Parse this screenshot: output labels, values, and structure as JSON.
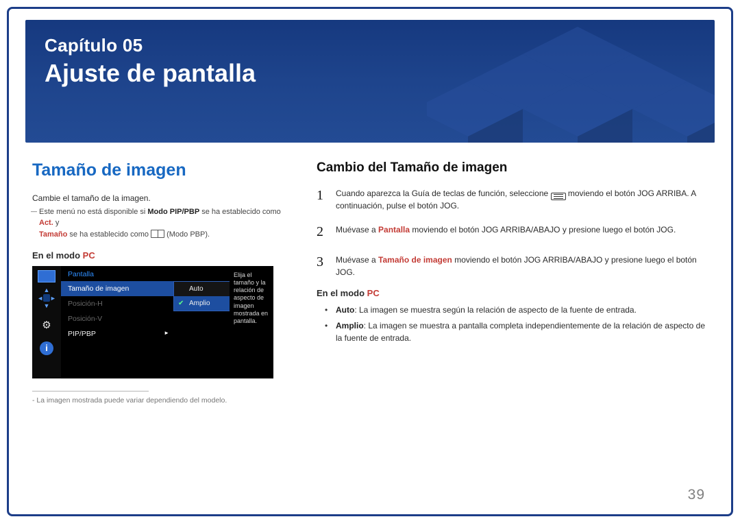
{
  "hero": {
    "chapter": "Capítulo 05",
    "title": "Ajuste de pantalla"
  },
  "left": {
    "heading": "Tamaño de imagen",
    "intro": "Cambie el tamaño de la imagen.",
    "note_pre": "Este menú no está disponible si ",
    "note_mid1": "Modo PIP/PBP",
    "note_mid2": " se ha establecido como ",
    "note_act": "Act.",
    "note_y": " y ",
    "note_tam": "Tamaño",
    "note_post1": " se ha establecido como ",
    "note_post2": " (Modo PBP).",
    "mode_label": "En el modo ",
    "mode_pc": "PC"
  },
  "osd": {
    "title": "Pantalla",
    "items": [
      "Tamaño de imagen",
      "Posición-H",
      "Posición-V",
      "PIP/PBP"
    ],
    "popup": [
      "Auto",
      "Amplio"
    ],
    "desc": "Elija el tamaño y la relación de aspecto de imagen mostrada en pantalla."
  },
  "footnote": "- La imagen mostrada puede variar dependiendo del modelo.",
  "right": {
    "heading": "Cambio del Tamaño de imagen",
    "s1a": "Cuando aparezca la Guía de teclas de función, seleccione ",
    "s1b": " moviendo el botón JOG ARRIBA. A continuación, pulse el botón JOG.",
    "s2a": "Muévase a ",
    "s2_p": "Pantalla",
    "s2b": " moviendo el botón JOG ARRIBA/ABAJO y presione luego el botón JOG.",
    "s3a": "Muévase a ",
    "s3_p": "Tamaño de imagen",
    "s3b": " moviendo el botón JOG ARRIBA/ABAJO y presione luego el botón JOG.",
    "mode_label": "En el modo ",
    "mode_pc": "PC",
    "b1_k": "Auto",
    "b1_t": ": La imagen se muestra según la relación de aspecto de la fuente de entrada.",
    "b2_k": "Amplio",
    "b2_t": ": La imagen se muestra a pantalla completa independientemente de la relación de aspecto de la fuente de entrada."
  },
  "page_number": "39"
}
